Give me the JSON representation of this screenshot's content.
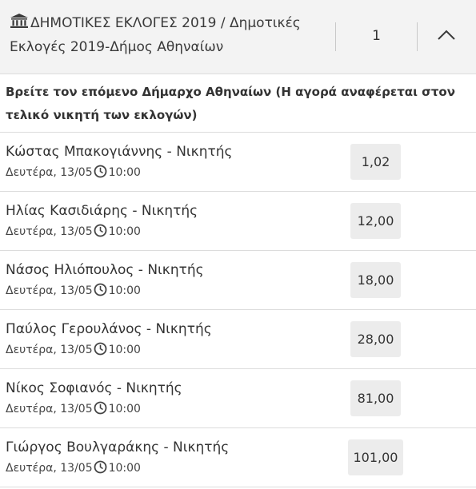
{
  "header": {
    "title": "ΔΗΜΟΤΙΚΕΣ ΕΚΛΟΓΕΣ 2019 / Δημοτικές Εκλογές 2019-Δήμος Αθηναίων",
    "count": "1",
    "icon": "bank-icon",
    "toggle_icon": "chevron-up-icon"
  },
  "market": {
    "question": "Βρείτε τον επόμενο Δήμαρχο Αθηναίων (Η αγορά αναφέρεται στον τελικό νικητή των εκλογών)"
  },
  "selections": [
    {
      "name": "Κώστας Μπακογιάννης - Νικητής",
      "date": "Δευτέρα, 13/05",
      "time": "10:00",
      "odds": "1,02"
    },
    {
      "name": "Ηλίας Κασιδιάρης - Νικητής",
      "date": "Δευτέρα, 13/05",
      "time": "10:00",
      "odds": "12,00"
    },
    {
      "name": "Νάσος Ηλιόπουλος - Νικητής",
      "date": "Δευτέρα, 13/05",
      "time": "10:00",
      "odds": "18,00"
    },
    {
      "name": "Παύλος Γερουλάνος - Νικητής",
      "date": "Δευτέρα, 13/05",
      "time": "10:00",
      "odds": "28,00"
    },
    {
      "name": "Νίκος Σοφιανός - Νικητής",
      "date": "Δευτέρα, 13/05",
      "time": "10:00",
      "odds": "81,00"
    },
    {
      "name": "Γιώργος Βουλγαράκης - Νικητής",
      "date": "Δευτέρα, 13/05",
      "time": "10:00",
      "odds": "101,00"
    }
  ]
}
